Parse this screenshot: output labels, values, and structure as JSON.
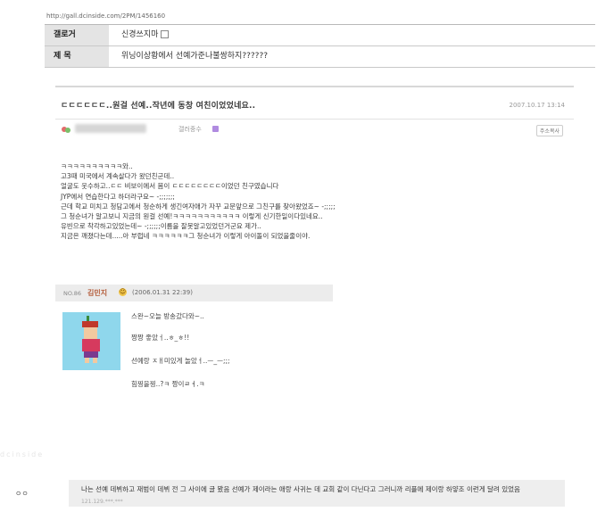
{
  "url": "http://gall.dcinside.com/2PM/1456160",
  "meta": {
    "gallery_key": "갤로거",
    "gallery_value": "신경쓰지마",
    "title_key": "제 목",
    "title_value": "위닝이상황에서 선예가준나불쌍하지??????"
  },
  "post": {
    "title": "ㄷㄷㄷㄷㄷㄷ..원걸 선예..작년에 동창 여친이었었네요..",
    "date": "2007.10.17 13:14",
    "author_role": "갤러중수",
    "address_button": "주소복사",
    "lines": [
      "ㅋㅋㅋㅋㅋㅋㅋㅋㅋㅋ와..",
      "  고3때 미국에서 계속살다가 왔던친군데..",
      "    얼굴도 웃수하고..ㄷㄷ 비보이에서 몸이 ㄷㄷㄷㄷㄷㄷㄷㄷ이었던 친구였습니다",
      "JYP에서 연습한다고 하더라구요~ -;;;;;;;",
      "근데 학교 미치고 청담고에서 청순하게 생긴여자애가 자꾸 교문앞으로 그친구를 찾아왔었죠~ -;;;;;",
      "그 청순녀가 알고보니 지금의 원걸 선예!ㅋㅋㅋㅋㅋㅋㅋㅋㅋㅋㅋ 이렇게 신기한일이다있네요..",
      "유빈으로 착각하고있었는데~ -;;;;;;이름을 잘못알고있었던거군요 제가..",
      "  지금은 깨졌다는데.....아 부럽네 ㅋㅋㅋㅋㅋㅋ그 청순녀가 이렇게 아이돌이 되었을줄이야."
    ]
  },
  "comment": {
    "no": "NO.86",
    "name": "김민지",
    "date": "(2006.01.31 22:39)",
    "lines": [
      "스완~오늘 방송갔다와~..",
      "짱짱 좋았ㅓ..ㅎ_ㅎ!!",
      "선예랑 ㅈㅐ미있게 놀았ㅓ..ㅡ_ㅡ;;;",
      "힘찡을찡..?ㅋ 짱이ㄹㅕ.ㅋ"
    ]
  },
  "watermark": "dcinside",
  "reply": {
    "nick": "ㅇㅇ",
    "text": "나는 선예 데뷔하고 재범이 데뷔 전 그 사이에 글 봤음 선예가 제이라는 애랑 사귀는 데 교회 같이 다닌다고 그러니까 리플에 제이랑 하얗조 이런게 달려 있었음",
    "meta": "121.129.***.***"
  }
}
